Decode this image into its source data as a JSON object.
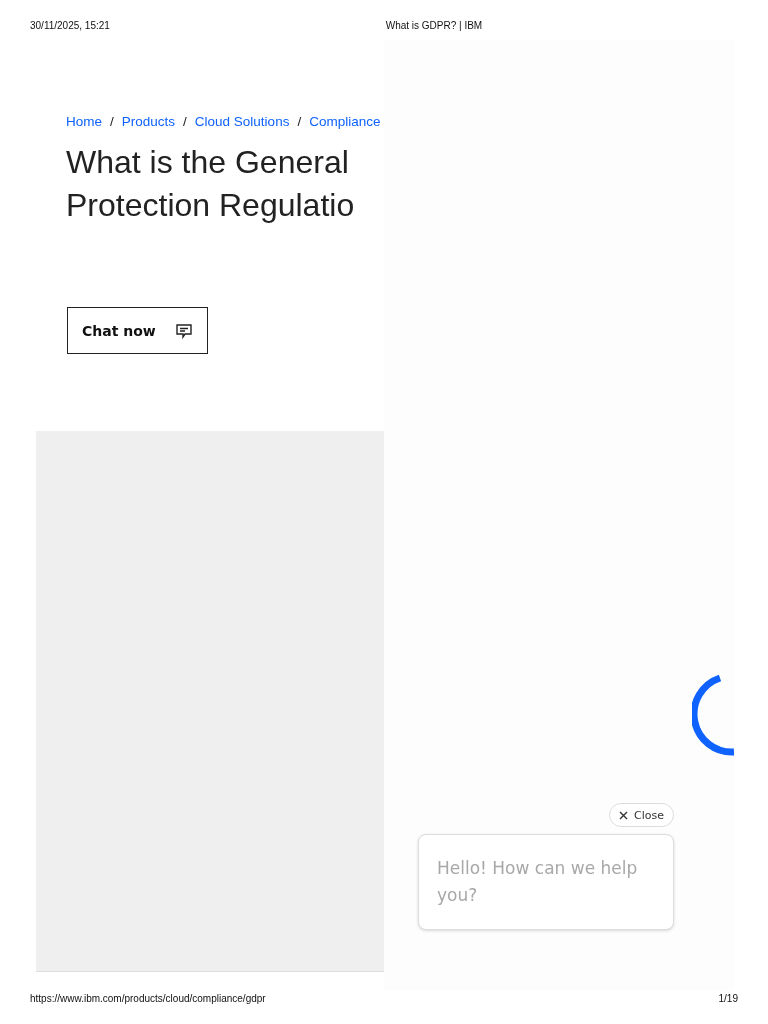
{
  "print_header": {
    "date": "30/11/2025, 15:21",
    "title": "What is GDPR? | IBM"
  },
  "breadcrumb": {
    "separator": "/",
    "links": [
      "Home",
      "Products",
      "Cloud Solutions",
      "Compliance"
    ]
  },
  "heading": [
    "What is the General",
    "Protection Regulatio"
  ],
  "chat_button": {
    "label": "Chat now"
  },
  "chat_popup": {
    "close": "Close",
    "message": "Hello! How can we help you?"
  },
  "print_footer": {
    "url": "https://www.ibm.com/products/cloud/compliance/gdpr",
    "page": "1/19"
  }
}
